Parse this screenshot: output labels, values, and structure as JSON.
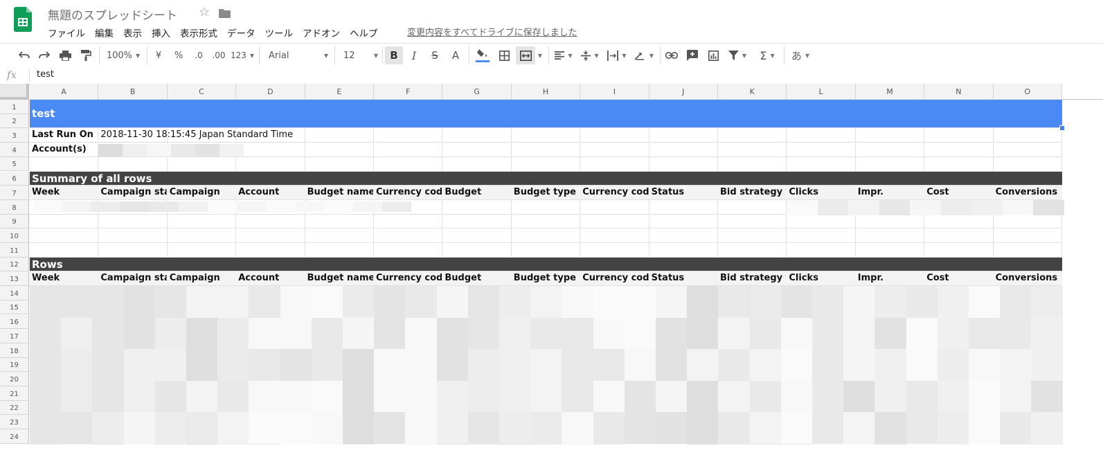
{
  "app": {
    "title": "無題のスプレッドシート",
    "save_status": "変更内容をすべてドライブに保存しました",
    "menu": [
      "ファイル",
      "編集",
      "表示",
      "挿入",
      "表示形式",
      "データ",
      "ツール",
      "アドオン",
      "ヘルプ"
    ]
  },
  "toolbar": {
    "zoom": "100%",
    "currency": "¥",
    "percent": "%",
    "decrease_decimal": ".0",
    "increase_decimal": ".00",
    "more_formats": "123",
    "font": "Arial",
    "font_size": "12",
    "input_tools": "あ"
  },
  "formula": {
    "fx": "fx",
    "value": "test"
  },
  "grid": {
    "columns": [
      "A",
      "B",
      "C",
      "D",
      "E",
      "F",
      "G",
      "H",
      "I",
      "J",
      "K",
      "L",
      "M",
      "N",
      "O"
    ],
    "rows": [
      "1",
      "2",
      "3",
      "4",
      "5",
      "6",
      "7",
      "8",
      "9",
      "10",
      "11",
      "12",
      "13",
      "14",
      "15",
      "16",
      "17",
      "18",
      "19",
      "20",
      "21",
      "22",
      "23",
      "24"
    ],
    "title_cell": "test",
    "last_run_label": "Last Run On",
    "last_run_value": "2018-11-30 18:15:45 Japan Standard Time",
    "accounts_label": "Account(s)",
    "summary_heading": "Summary of all rows",
    "rows_heading": "Rows",
    "headers": [
      "Week",
      "Campaign statu",
      "Campaign",
      "Account",
      "Budget name",
      "Currency code",
      "Budget",
      "Budget type",
      "Currency code",
      "Status",
      "Bid strategy typ",
      "Clicks",
      "Impr.",
      "Cost",
      "Conversions"
    ]
  },
  "colors": {
    "title_band": "#4a8af4",
    "section_band": "#434343",
    "header_row": "#f3f3f3",
    "sheets_green": "#0f9d58"
  }
}
